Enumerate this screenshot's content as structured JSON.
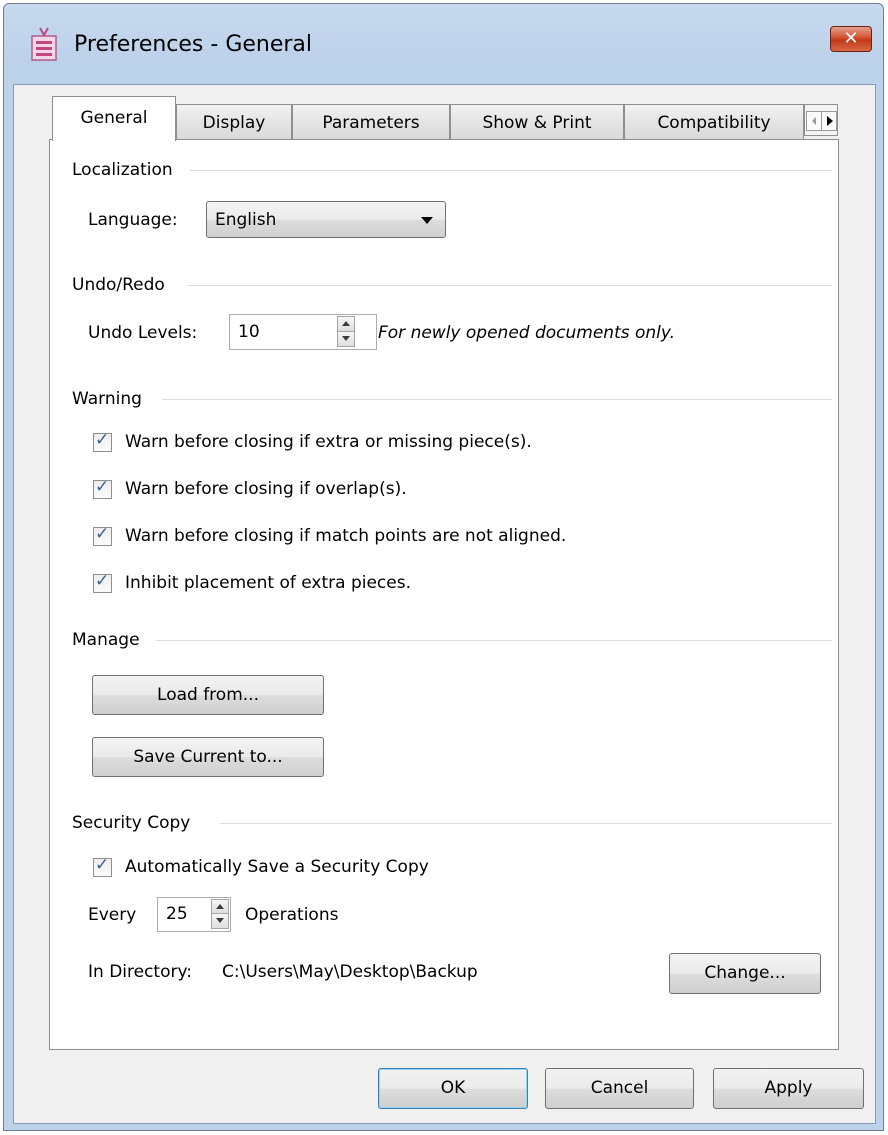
{
  "window": {
    "title": "Preferences - General",
    "close_glyph": "✕"
  },
  "tabs": [
    {
      "label": "General",
      "active": true
    },
    {
      "label": "Display"
    },
    {
      "label": "Parameters"
    },
    {
      "label": "Show & Print"
    },
    {
      "label": "Compatibility"
    }
  ],
  "localization": {
    "header": "Localization",
    "language_label": "Language:",
    "language_value": "English"
  },
  "undo": {
    "header": "Undo/Redo",
    "levels_label": "Undo Levels:",
    "levels_value": "10",
    "note": "For newly opened documents only."
  },
  "warning": {
    "header": "Warning",
    "items": [
      {
        "label": "Warn before closing if extra or missing piece(s).",
        "checked": true
      },
      {
        "label": "Warn before closing if overlap(s).",
        "checked": true
      },
      {
        "label": "Warn before closing if match points are not aligned.",
        "checked": true
      },
      {
        "label": "Inhibit placement of extra pieces.",
        "checked": true
      }
    ]
  },
  "manage": {
    "header": "Manage",
    "load_label": "Load from...",
    "save_label": "Save Current to..."
  },
  "security": {
    "header": "Security Copy",
    "auto_save_label": "Automatically Save a Security Copy",
    "auto_save_checked": true,
    "every_label": "Every",
    "every_value": "25",
    "operations_label": "Operations",
    "directory_label": "In Directory:",
    "directory_value": "C:\\Users\\May\\Desktop\\Backup",
    "change_label": "Change..."
  },
  "footer": {
    "ok_label": "OK",
    "cancel_label": "Cancel",
    "apply_label": "Apply"
  },
  "check_glyph": "✓"
}
